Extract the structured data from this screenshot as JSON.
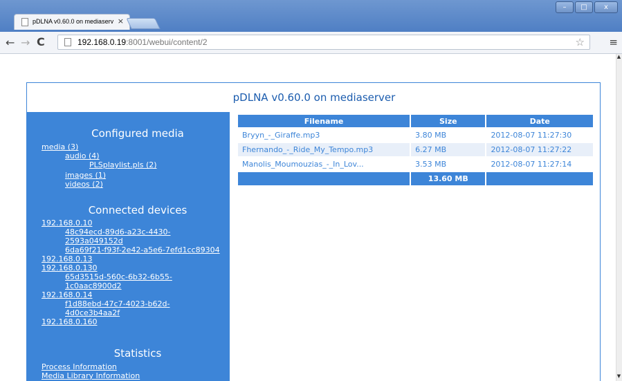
{
  "browser": {
    "tab_title": "pDLNA v0.60.0 on mediaserv",
    "tab_close": "×",
    "url_host": "192.168.0.19",
    "url_rest": ":8001/webui/content/2",
    "window_buttons": [
      "–",
      "□",
      "x"
    ]
  },
  "page": {
    "title": "pDLNA v0.60.0 on mediaserver"
  },
  "sidebar": {
    "configured_media": {
      "heading": "Configured media",
      "items": [
        {
          "label": "media (3)"
        },
        {
          "label": "audio (4)"
        },
        {
          "label": "PLSplaylist.pls (2)"
        },
        {
          "label": "images (1)"
        },
        {
          "label": "videos (2)"
        }
      ]
    },
    "connected_devices": {
      "heading": "Connected devices",
      "items": [
        {
          "label": "192.168.0.10"
        },
        {
          "label": "48c94ecd-89d6-a23c-4430-"
        },
        {
          "label": "2593a049152d"
        },
        {
          "label": "6da69f21-f93f-2e42-a5e6-7efd1cc89304"
        },
        {
          "label": "192.168.0.13"
        },
        {
          "label": "192.168.0.130"
        },
        {
          "label": "65d3515d-560c-6b32-6b55-"
        },
        {
          "label": "1c0aac8900d2"
        },
        {
          "label": "192.168.0.14"
        },
        {
          "label": "f1d88ebd-47c7-4023-b62d-"
        },
        {
          "label": "4d0ce3b4aa2f"
        },
        {
          "label": "192.168.0.160"
        }
      ]
    },
    "statistics": {
      "heading": "Statistics",
      "items": [
        {
          "label": "Process Information"
        },
        {
          "label": "Media Library Information"
        }
      ]
    }
  },
  "table": {
    "headers": [
      "Filename",
      "Size",
      "Date"
    ],
    "rows": [
      {
        "filename": "Bryyn_-_Giraffe.mp3",
        "size": "3.80 MB",
        "date": "2012-08-07 11:27:30"
      },
      {
        "filename": "Fhernando_-_Ride_My_Tempo.mp3",
        "size": "6.27 MB",
        "date": "2012-08-07 11:27:22"
      },
      {
        "filename": "Manolis_Moumouzias_-_In_Lov...",
        "size": "3.53 MB",
        "date": "2012-08-07 11:27:14"
      }
    ],
    "total": "13.60 MB"
  },
  "icons": [
    "page-icon",
    "close-icon",
    "back-arrow-icon",
    "forward-arrow-icon",
    "reload-icon",
    "star-icon",
    "menu-icon"
  ],
  "colors": {
    "accent": "#3d85d8",
    "titlebar": "#5b88c9"
  }
}
